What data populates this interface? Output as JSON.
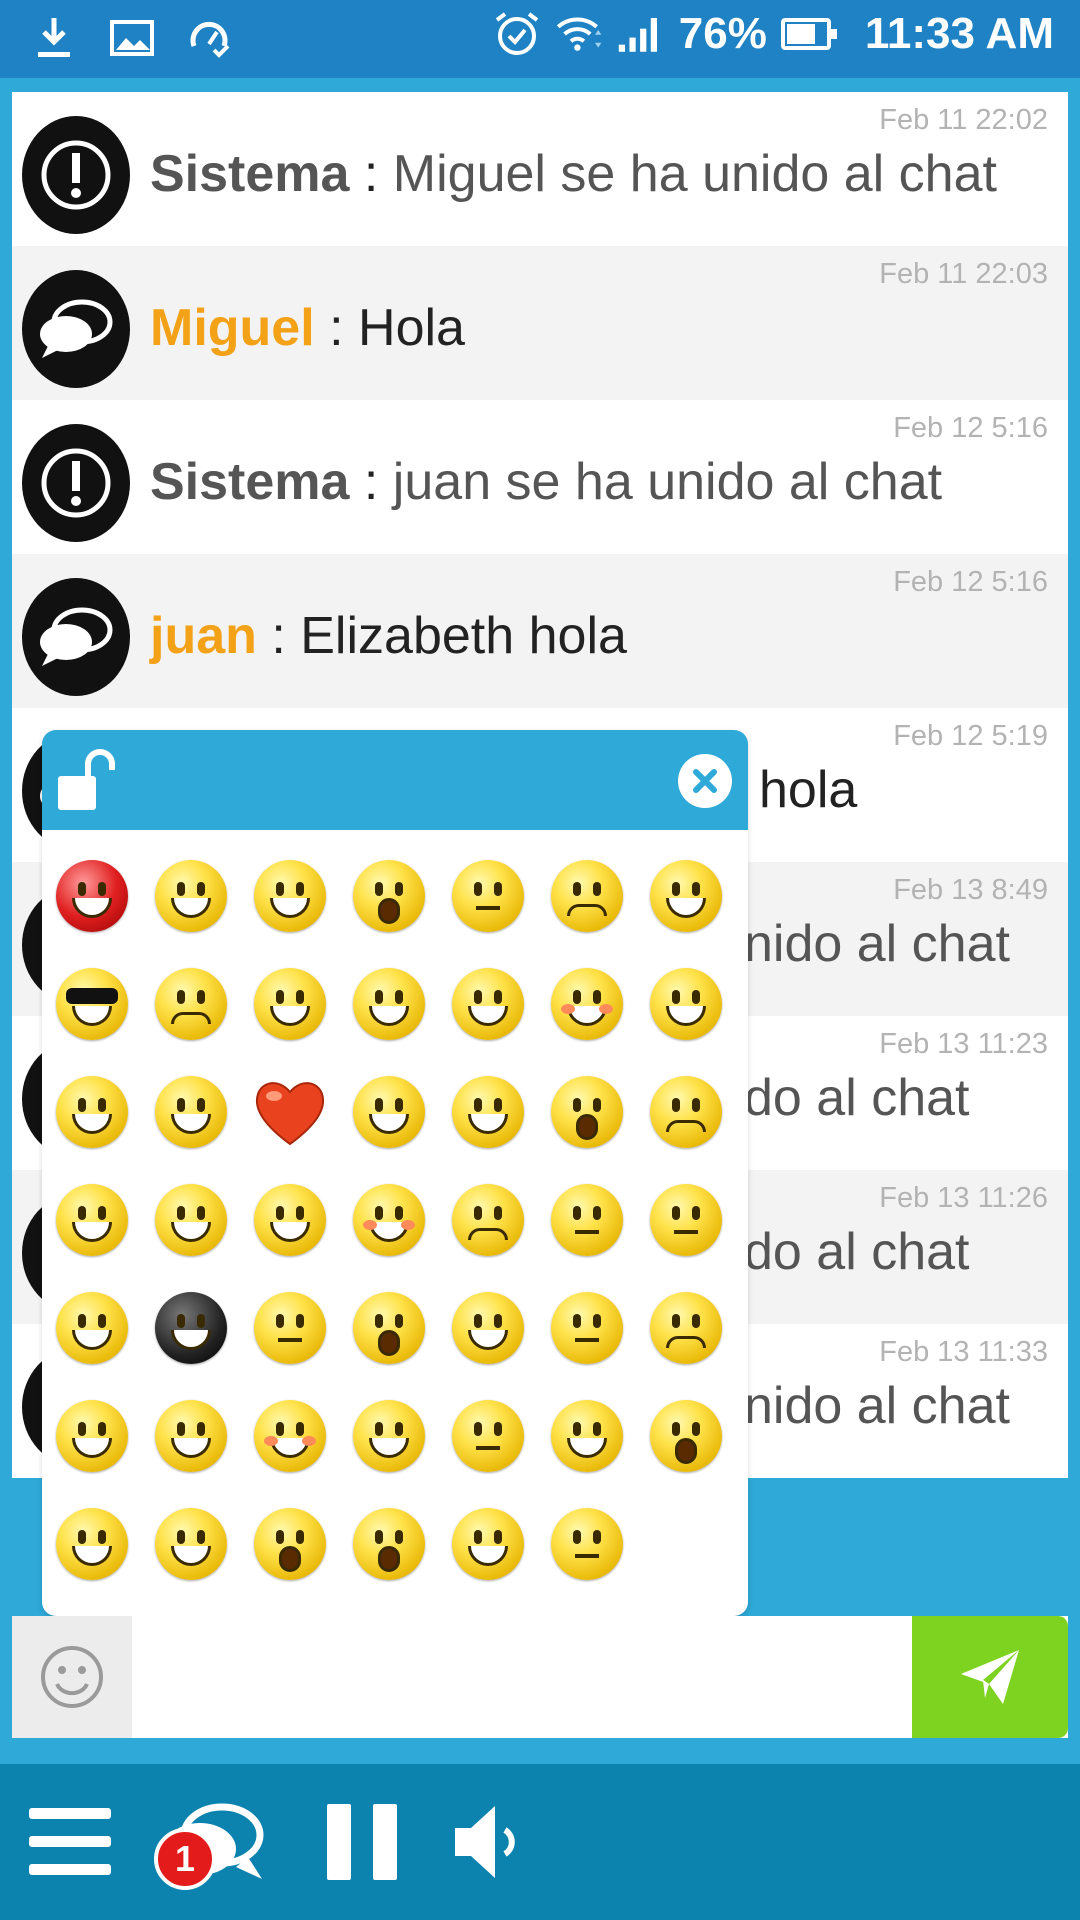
{
  "status_bar": {
    "battery_percent": "76%",
    "time": "11:33 AM",
    "left_icons": [
      "download-icon",
      "image-icon",
      "speed-check-icon"
    ],
    "right_icons": [
      "alarm-icon",
      "wifi-icon",
      "signal-icon",
      "battery-icon"
    ]
  },
  "messages": [
    {
      "sender": "Sistema",
      "sender_type": "system",
      "separator": " : ",
      "text": "Miguel se ha unido al chat",
      "time": "Feb 11 22:02",
      "avatar": "alert-icon"
    },
    {
      "sender": "Miguel",
      "sender_type": "user",
      "separator": " : ",
      "text": "Hola",
      "time": "Feb 11 22:03",
      "avatar": "chat-bubbles-icon"
    },
    {
      "sender": "Sistema",
      "sender_type": "system",
      "separator": " : ",
      "text": "juan se ha unido al chat",
      "time": "Feb 12 5:16",
      "avatar": "alert-icon"
    },
    {
      "sender": "juan",
      "sender_type": "user",
      "separator": " : ",
      "text": "Elizabeth hola",
      "time": "Feb 12 5:16",
      "avatar": "chat-bubbles-icon"
    },
    {
      "sender": "",
      "sender_type": "user",
      "separator": "",
      "text": "hola",
      "time": "Feb 12 5:19",
      "avatar": "chat-bubbles-icon"
    },
    {
      "sender": "",
      "sender_type": "system",
      "separator": "",
      "text": "nido al chat",
      "time": "Feb 13 8:49",
      "avatar": "alert-icon"
    },
    {
      "sender": "",
      "sender_type": "system",
      "separator": "",
      "text": "do al chat",
      "time": "Feb 13 11:23",
      "avatar": "alert-icon"
    },
    {
      "sender": "",
      "sender_type": "system",
      "separator": "",
      "text": "do al chat",
      "time": "Feb 13 11:26",
      "avatar": "alert-icon"
    },
    {
      "sender": "",
      "sender_type": "system",
      "separator": "",
      "text": "nido al chat",
      "time": "Feb 13 11:33",
      "avatar": "alert-icon"
    }
  ],
  "emoji_panel": {
    "lock_icon": "unlock-icon",
    "close_icon": "close-icon",
    "rows": [
      [
        "angry-red",
        "grin",
        "smirk",
        "eye-roll",
        "skeptical",
        "sad",
        "laugh-hands"
      ],
      [
        "cool-sunglasses",
        "crying",
        "devil",
        "facepalm",
        "dizzy",
        "rose",
        "happy-squint"
      ],
      [
        "idea",
        "thumbs-up-grin",
        "heart",
        "wave",
        "thinking",
        "shocked-hands",
        "confused-shrug"
      ],
      [
        "big-grin",
        "tears-of-joy",
        "heart-eyes",
        "hug-heart",
        "grimace",
        "zipper-mouth",
        "neutral"
      ],
      [
        "thumbs-up-smile",
        "ninja",
        "plain-smile",
        "scream",
        "cheer",
        "hushed",
        "worried"
      ],
      [
        "evil-grin",
        "hands-over-eyes",
        "blush",
        "grin-teeth",
        "sleepy",
        "smile",
        "yawn"
      ],
      [
        "tongue-wink",
        "tongue-out",
        "surprised",
        "astonished",
        "celebrate",
        "expressionless"
      ]
    ]
  },
  "input_bar": {
    "placeholder": "",
    "emoji_button_icon": "smiley-icon",
    "send_button_icon": "send-plane-icon"
  },
  "bottom_bar": {
    "menu_icon": "hamburger-menu-icon",
    "chats_icon": "chat-bubbles-icon",
    "unread_count": "1",
    "pause_icon": "pause-icon",
    "sound_icon": "speaker-icon"
  },
  "colors": {
    "accent": "#2ea9d8",
    "status_bar": "#1e82c4",
    "bottom_bar": "#0b83ae",
    "user_name": "#f3a117",
    "send_button": "#7ed321",
    "badge": "#e41b1b"
  }
}
